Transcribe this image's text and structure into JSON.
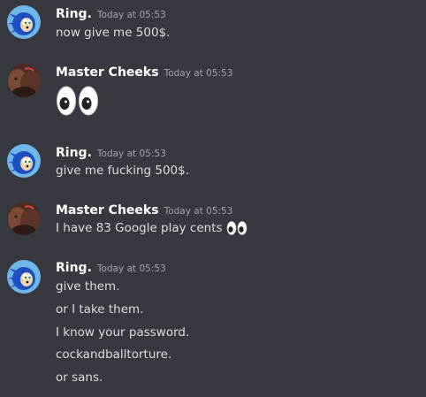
{
  "channel": {
    "messages": [
      {
        "author": "Ring.",
        "timestamp": "Today at 05:53",
        "lines": [
          "now give me 500$."
        ]
      },
      {
        "author": "Master Cheeks",
        "timestamp": "Today at 05:53",
        "lines": [
          ""
        ],
        "emoji": "eyes-emoji"
      },
      {
        "author": "Ring.",
        "timestamp": "Today at 05:53",
        "lines": [
          "give me fucking 500$."
        ]
      },
      {
        "author": "Master Cheeks",
        "timestamp": "Today at 05:53",
        "lines": [
          "I have 83 Google play cents"
        ],
        "emoji": "eyes-emoji"
      },
      {
        "author": "Ring.",
        "timestamp": "Today at 05:53",
        "lines": [
          "give them.",
          "or I take them.",
          "I know your password.",
          "cockandballtorture.",
          "or sans."
        ]
      }
    ]
  },
  "colors": {
    "background": "#36393f",
    "username": "#ffffff",
    "timestamp": "#a3a6aa",
    "message_text": "#dcddde"
  }
}
